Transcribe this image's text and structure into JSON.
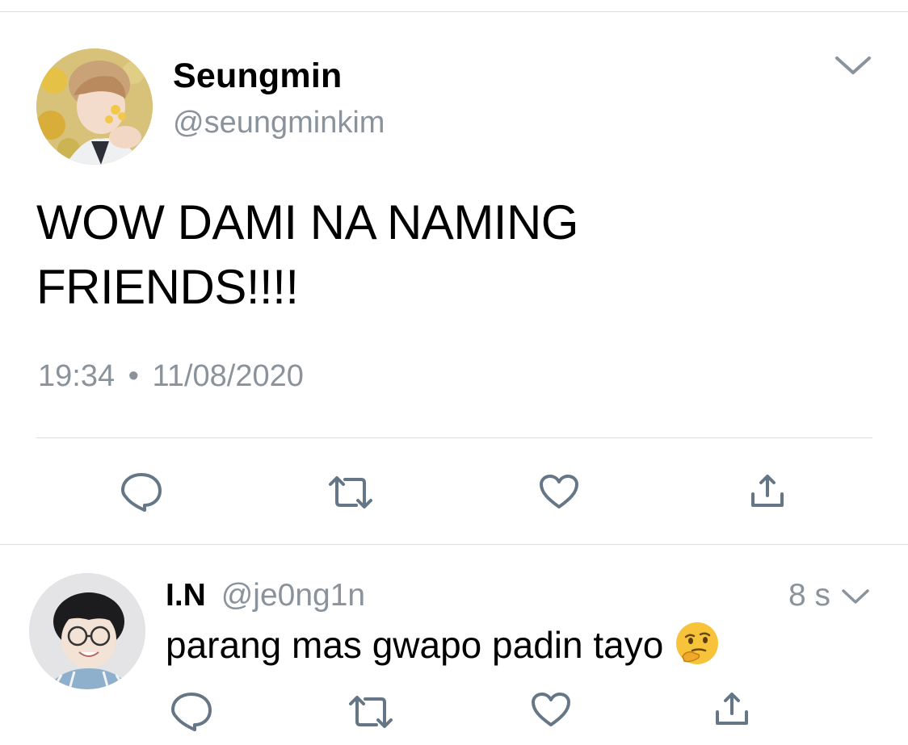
{
  "tweet": {
    "author_name": "Seungmin",
    "author_handle": "@seungminkim",
    "text_line1": "WOW DAMI NA NAMING",
    "text_line2": "FRIENDS!!!!",
    "time": "19:34",
    "separator": "•",
    "date": "11/08/2020",
    "menu_icon": "chevron-down-icon",
    "actions": [
      "reply-icon",
      "retweet-icon",
      "like-icon",
      "share-icon"
    ]
  },
  "reply": {
    "author_name": "I.N",
    "author_handle": "@je0ng1n",
    "time": "8 s",
    "text": "parang mas gwapo padin tayo",
    "emoji": "thinking-face-emoji",
    "actions": [
      "reply-icon",
      "retweet-icon",
      "like-icon",
      "share-icon"
    ]
  },
  "colors": {
    "icon_gray": "#657786",
    "secondary_text": "#8a939b",
    "divider": "#d9dde0"
  }
}
